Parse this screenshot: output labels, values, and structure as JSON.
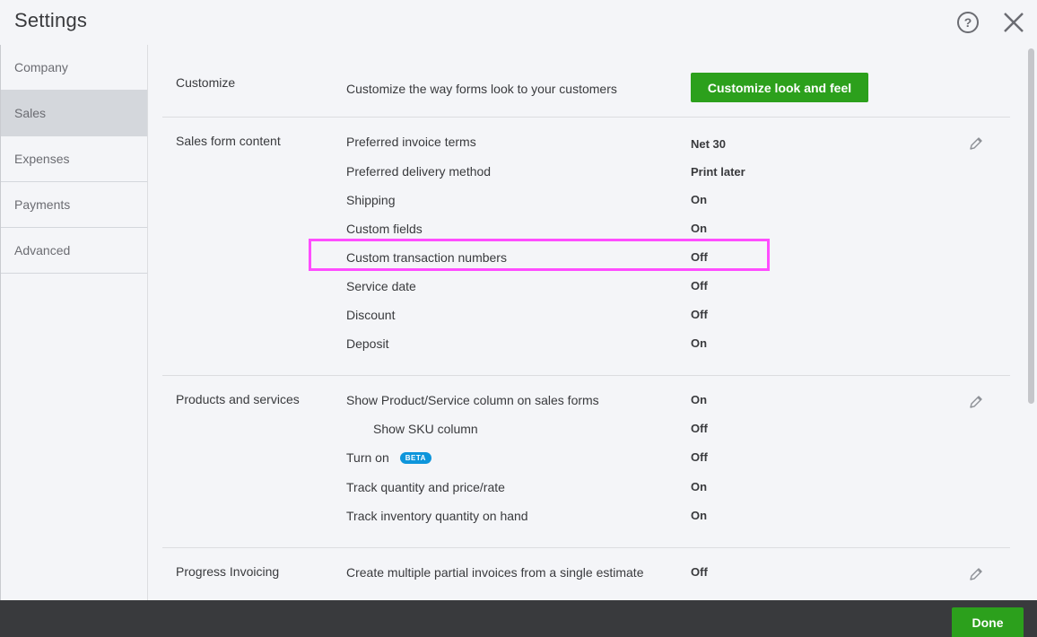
{
  "header": {
    "title": "Settings",
    "help_icon": "help-circle-icon",
    "close_icon": "close-icon"
  },
  "sidebar": {
    "items": [
      {
        "label": "Company",
        "active": false
      },
      {
        "label": "Sales",
        "active": true
      },
      {
        "label": "Expenses",
        "active": false
      },
      {
        "label": "Payments",
        "active": false
      },
      {
        "label": "Advanced",
        "active": false
      }
    ]
  },
  "sections": {
    "customize": {
      "label": "Customize",
      "description": "Customize the way forms look to your customers",
      "button_label": "Customize look and feel"
    },
    "sales_form_content": {
      "label": "Sales form content",
      "rows": [
        {
          "label": "Preferred invoice terms",
          "value": "Net 30"
        },
        {
          "label": "Preferred delivery method",
          "value": "Print later"
        },
        {
          "label": "Shipping",
          "value": "On"
        },
        {
          "label": "Custom fields",
          "value": "On"
        },
        {
          "label": "Custom transaction numbers",
          "value": "Off"
        },
        {
          "label": "Service date",
          "value": "Off"
        },
        {
          "label": "Discount",
          "value": "Off"
        },
        {
          "label": "Deposit",
          "value": "On"
        }
      ]
    },
    "products_services": {
      "label": "Products and services",
      "rows": [
        {
          "label": "Show Product/Service column on sales forms",
          "value": "On"
        },
        {
          "label": "Show SKU column",
          "value": "Off"
        },
        {
          "label": "Turn on",
          "badge": "BETA",
          "value": "Off"
        },
        {
          "label": "Track quantity and price/rate",
          "value": "On"
        },
        {
          "label": "Track inventory quantity on hand",
          "value": "On"
        }
      ]
    },
    "progress_invoicing": {
      "label": "Progress Invoicing",
      "rows": [
        {
          "label": "Create multiple partial invoices from a single estimate",
          "value": "Off"
        }
      ]
    }
  },
  "footer": {
    "done_label": "Done"
  },
  "colors": {
    "accent_green": "#2ca01c",
    "highlight": "#ff4dff",
    "beta_badge": "#0d95db",
    "footer_bg": "#393a3d"
  }
}
